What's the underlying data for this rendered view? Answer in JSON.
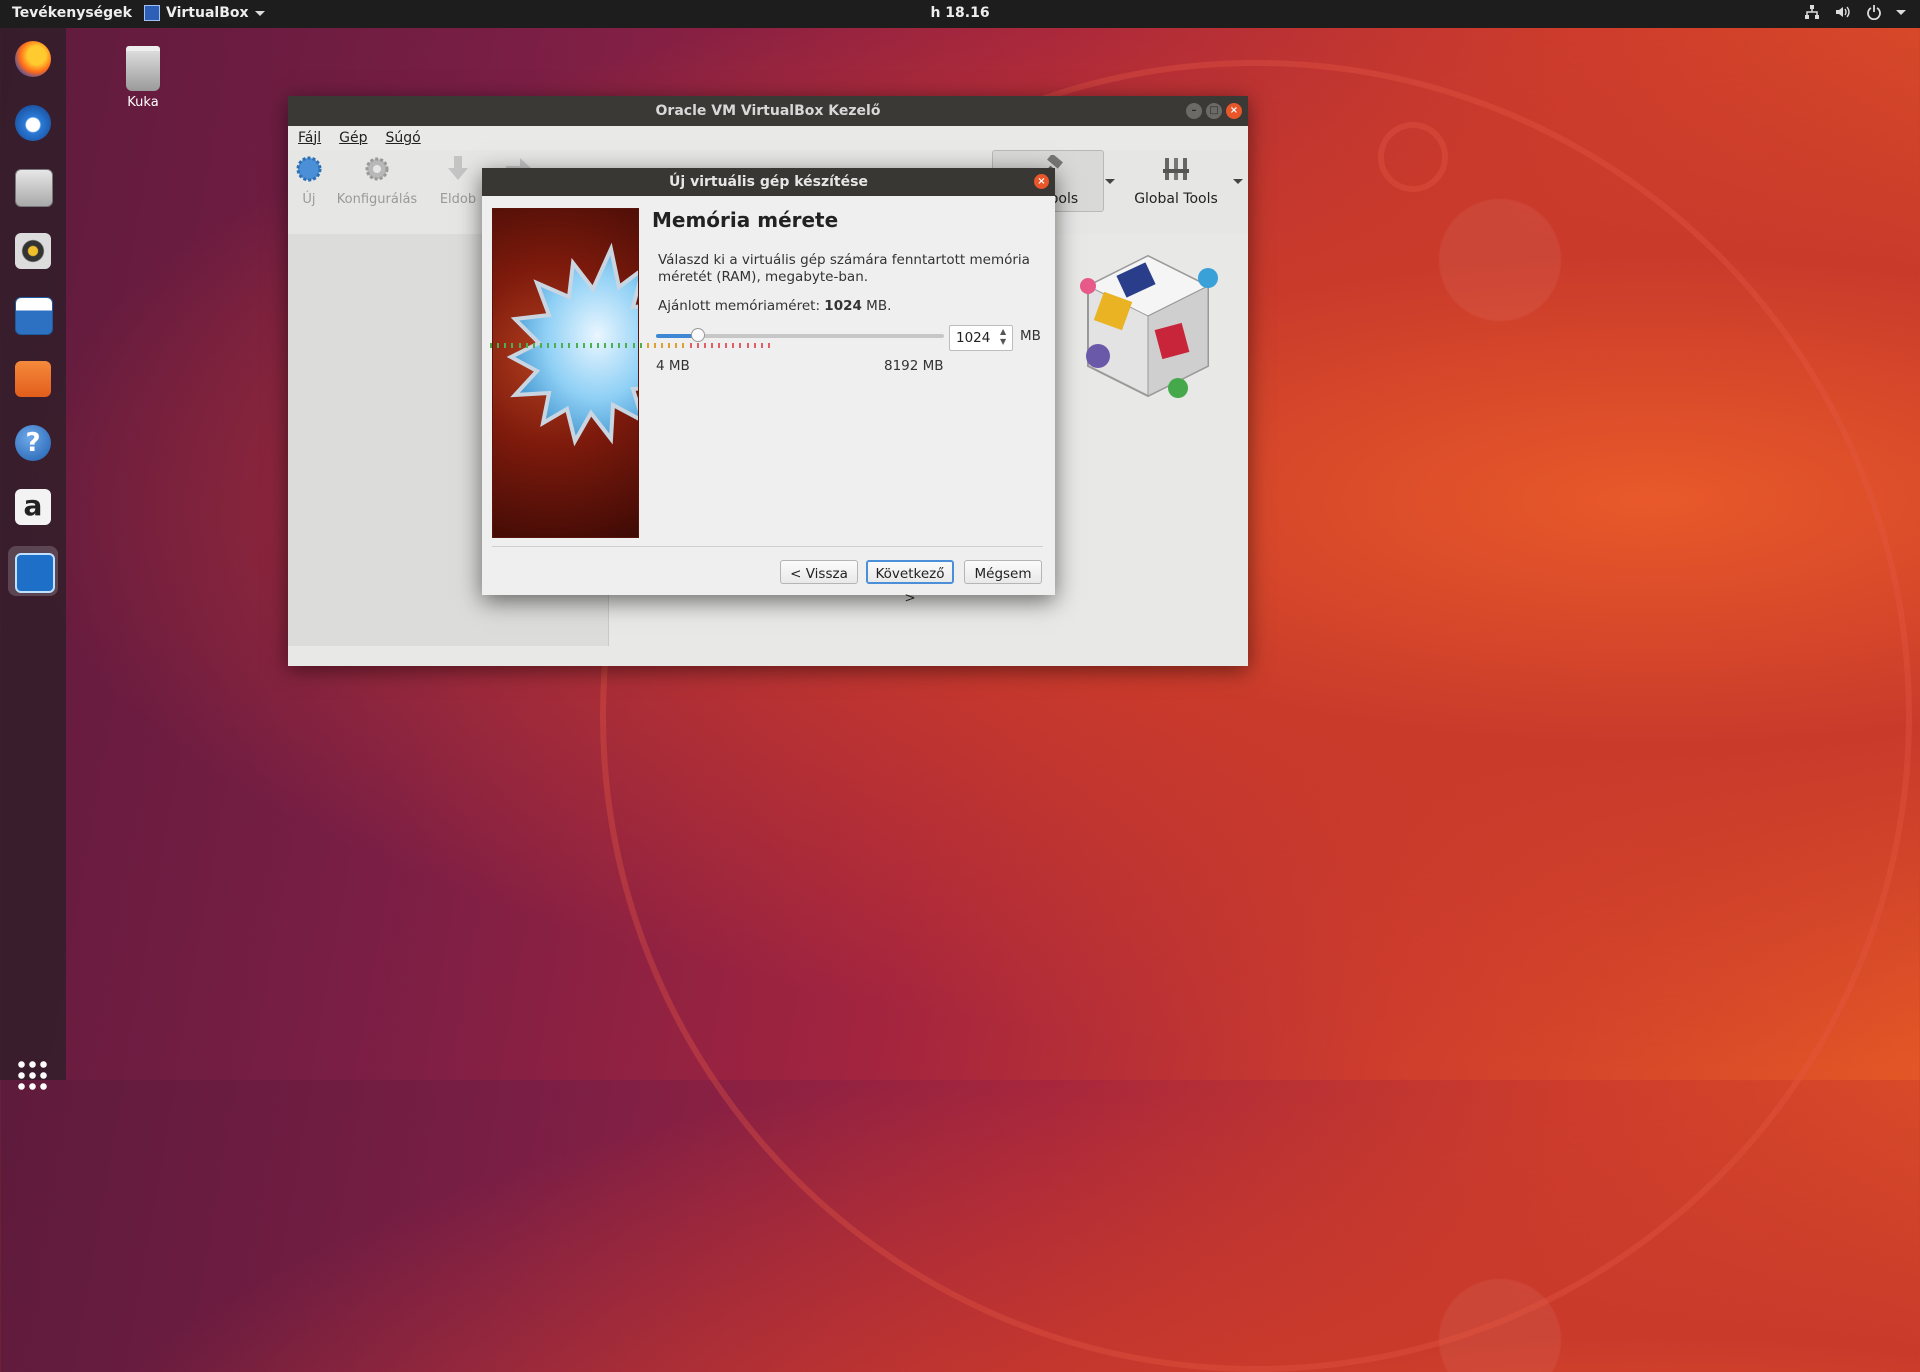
{
  "topbar": {
    "activities": "Tevékenységek",
    "app_name": "VirtualBox",
    "clock": "h 18.16",
    "tray_icons": [
      "network-icon",
      "volume-icon",
      "power-icon"
    ]
  },
  "dock": {
    "items": [
      "firefox-icon",
      "thunderbird-icon",
      "files-icon",
      "rhythmbox-icon",
      "libreoffice-writer-icon",
      "software-center-icon",
      "help-icon",
      "amazon-icon",
      "system-monitor-icon"
    ],
    "apps_grid": "show-applications-icon"
  },
  "desktop": {
    "trash_label": "Kuka"
  },
  "vbox": {
    "title": "Oracle VM VirtualBox Kezelő",
    "menu": [
      "Fájl",
      "Gép",
      "Súgó"
    ],
    "toolbar": [
      "Új",
      "Konfigurálás",
      "Eldob"
    ],
    "machine_tools": "ine Tools",
    "global_tools": "Global Tools"
  },
  "wizard": {
    "title": "Új virtuális gép készítése",
    "heading": "Memória mérete",
    "description": "Válaszd ki a virtuális gép számára fenntartott memória méretét (RAM), megabyte-ban.",
    "recommended_prefix": "Ajánlott memóriaméret:",
    "recommended_value": "1024",
    "recommended_suffix": "MB.",
    "memory_value": "1024",
    "unit": "MB",
    "slider_min_label": "4 MB",
    "slider_max_label": "8192 MB",
    "slider_fraction": 0.125,
    "buttons": {
      "back": "< Vissza",
      "next": "Következő >",
      "cancel": "Mégsem"
    }
  },
  "colors": {
    "accent": "#3d87d4",
    "close": "#e8562a",
    "titlebar": "#3a3936"
  }
}
